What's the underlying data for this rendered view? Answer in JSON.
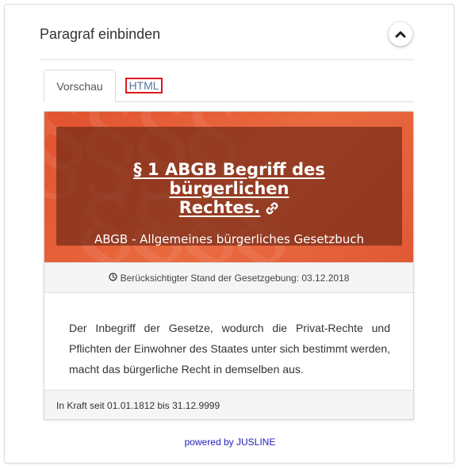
{
  "panel": {
    "title": "Paragraf einbinden"
  },
  "tabs": [
    {
      "label": "Vorschau",
      "active": true
    },
    {
      "label": "HTML",
      "active": false
    }
  ],
  "card": {
    "title_line1": "§ 1 ABGB Begriff des bürgerlichen",
    "title_line2": "Rechtes.",
    "subtitle": "ABGB - Allgemeines bürgerliches Gesetzbuch",
    "stand": "Berücksichtigter Stand der Gesetzgebung: 03.12.2018",
    "body": "Der Inbegriff der Gesetze, wodurch die Privat-Rechte und Pflichten der Einwohner des Staates unter sich bestimmt werden, macht das bürgerliche Recht in demselben aus.",
    "in_kraft": "In Kraft seit 01.01.1812 bis 31.12.9999"
  },
  "footer": {
    "powered_by": "powered by JUSLINE"
  },
  "icons": {
    "collapse": "chevron-up-icon",
    "link": "link-icon",
    "stand": "clock-icon"
  },
  "colors": {
    "hero_orange": "#e95f38",
    "hero_overlay": "#6e2816",
    "tab_highlight": "#e0181e",
    "link_blue": "#2222bb"
  }
}
